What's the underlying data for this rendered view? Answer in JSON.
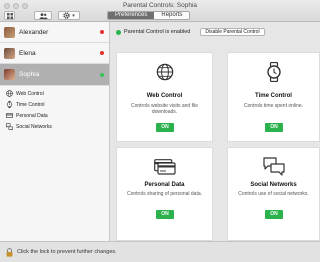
{
  "window": {
    "title": "Parental Controls: Sophia"
  },
  "toolbar": {
    "tabs": [
      "Preferences",
      "Reports"
    ]
  },
  "sidebar": {
    "users": [
      {
        "name": "Alexander",
        "status_color": "#e0322a"
      },
      {
        "name": "Elena",
        "status_color": "#e0322a"
      },
      {
        "name": "Sophia",
        "status_color": "#35c45b"
      }
    ],
    "sub_items": [
      "Web Control",
      "Time Control",
      "Personal Data",
      "Social Networks"
    ]
  },
  "status": {
    "enabled_text": "Parental Control is enabled",
    "disable_label": "Disable Parental Control"
  },
  "cards": [
    {
      "title": "Web Control",
      "description": "Controls website visits and file downloads.",
      "button": "ON",
      "icon": "globe-icon"
    },
    {
      "title": "Time Control",
      "description": "Controls time spent online.",
      "button": "ON",
      "icon": "watch-icon"
    },
    {
      "title": "Personal Data",
      "description": "Controls sharing of personal data.",
      "button": "ON",
      "icon": "credit-card-icon"
    },
    {
      "title": "Social Networks",
      "description": "Controls use of social networks.",
      "button": "ON",
      "icon": "chat-bubbles-icon"
    }
  ],
  "footer": {
    "lock_text": "Click the lock to prevent further changes."
  }
}
